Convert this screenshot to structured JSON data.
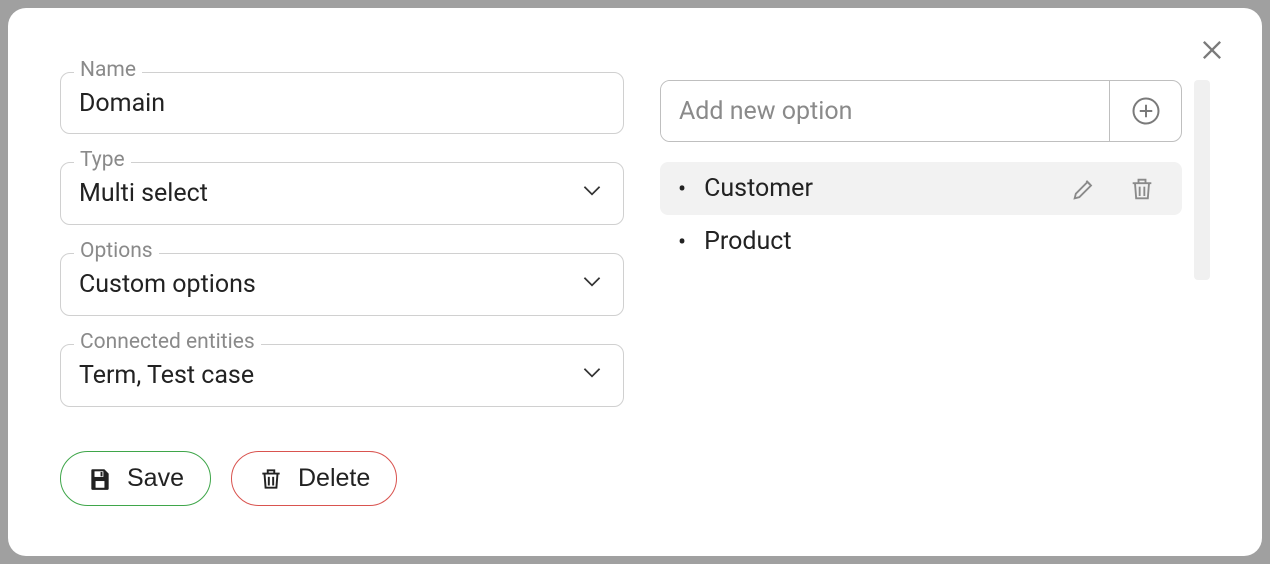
{
  "form": {
    "name": {
      "label": "Name",
      "value": "Domain"
    },
    "type": {
      "label": "Type",
      "value": "Multi select"
    },
    "options": {
      "label": "Options",
      "value": "Custom options"
    },
    "connected": {
      "label": "Connected entities",
      "value": "Term, Test case"
    }
  },
  "buttons": {
    "save": "Save",
    "delete": "Delete"
  },
  "optionInput": {
    "placeholder": "Add new option"
  },
  "optionsList": [
    {
      "label": "Customer",
      "hovered": true
    },
    {
      "label": "Product",
      "hovered": false
    }
  ]
}
